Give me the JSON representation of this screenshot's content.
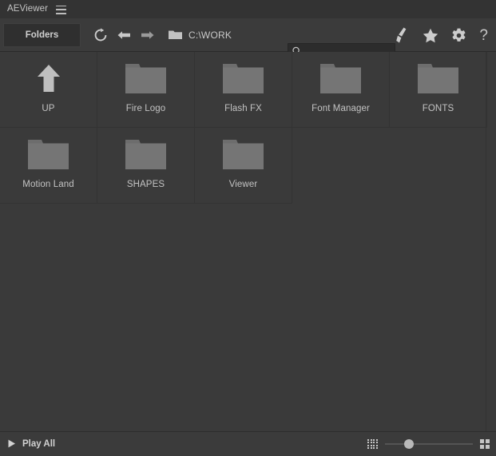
{
  "window": {
    "app_title": "AEViewer",
    "menu_icon": "hamburger-icon"
  },
  "toolbar": {
    "tab_label": "Folders",
    "refresh_icon": "refresh-icon",
    "back_icon": "arrow-left-icon",
    "forward_icon": "arrow-right-icon",
    "path_folder_icon": "folder-icon",
    "path": "C:\\WORK",
    "search": {
      "icon": "search-icon",
      "value": "",
      "placeholder": ""
    },
    "actions": [
      {
        "name": "paint-bucket-icon",
        "glyph": "⚒"
      },
      {
        "name": "star-icon",
        "glyph": "★"
      },
      {
        "name": "gear-icon",
        "glyph": "⚙"
      },
      {
        "name": "help-icon",
        "glyph": "?"
      }
    ]
  },
  "content": {
    "items": [
      {
        "label": "UP",
        "type": "up"
      },
      {
        "label": "Fire Logo",
        "type": "folder"
      },
      {
        "label": "Flash FX",
        "type": "folder"
      },
      {
        "label": "Font Manager",
        "type": "folder"
      },
      {
        "label": "FONTS",
        "type": "folder"
      },
      {
        "label": "Motion Land",
        "type": "folder"
      },
      {
        "label": "SHAPES",
        "type": "folder"
      },
      {
        "label": "Viewer",
        "type": "folder"
      }
    ]
  },
  "statusbar": {
    "play_all_label": "Play All",
    "play_icon": "play-triangle-icon",
    "thumb_small_icon": "grid-small-icon",
    "thumb_large_icon": "grid-large-icon",
    "zoom_slider_value": 27
  },
  "colors": {
    "background": "#3a3a3a",
    "titlebar": "#333333",
    "toolbar": "#3b3b3b",
    "text": "#c8c8c8",
    "folder": "#757575",
    "divider": "#333333"
  }
}
